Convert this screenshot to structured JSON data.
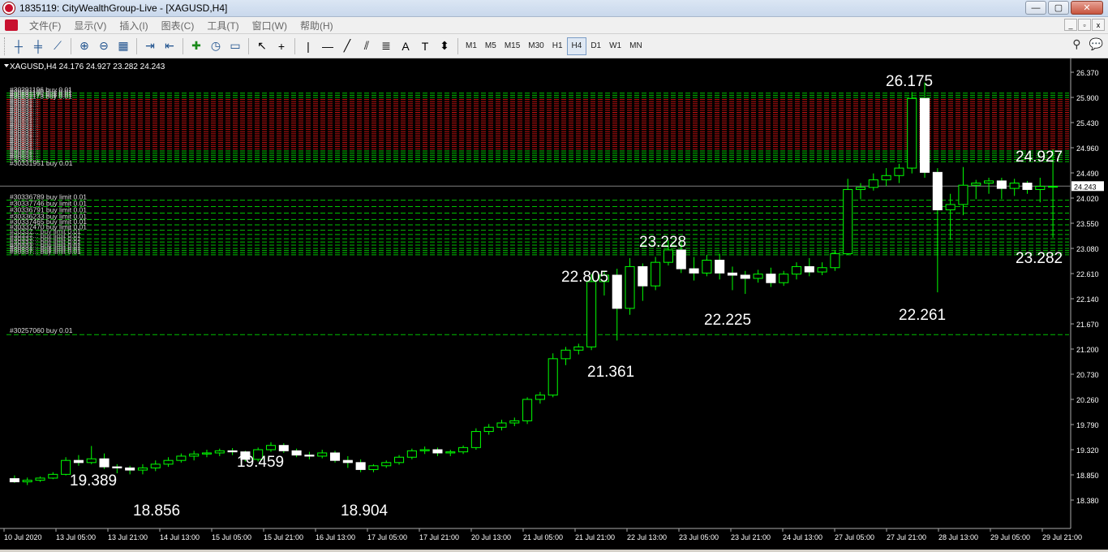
{
  "window": {
    "title": "1835119: CityWealthGroup-Live - [XAGUSD,H4]",
    "buttons": [
      "—",
      "▢",
      "✕"
    ]
  },
  "menu": {
    "items": [
      "文件(F)",
      "显示(V)",
      "插入(I)",
      "图表(C)",
      "工具(T)",
      "窗口(W)",
      "帮助(H)"
    ],
    "mdi_buttons": [
      "_",
      "▫",
      "x"
    ]
  },
  "toolbar": {
    "timeframes": [
      "M1",
      "M5",
      "M15",
      "M30",
      "H1",
      "H4",
      "D1",
      "W1",
      "MN"
    ],
    "active_timeframe": "H4"
  },
  "chart": {
    "header": "XAGUSD,H4  24.176 24.927 23.282 24.243",
    "current_price": "24.243",
    "colors": {
      "background": "#000000",
      "up_body": "#ffffff",
      "down_body": "#ffffff",
      "wick": "#00ff00",
      "grid": "#222222",
      "order_line": "#00c000",
      "stop_line": "#c00000",
      "price_line": "#808080"
    },
    "order_labels_top": [
      "#30291196 buy 0.01",
      "#30291180 buy 0.01",
      "#30291175 buy 0.01",
      "#30291173 buy 0.01"
    ],
    "order_labels_top_bottom": [
      "#30331951 buy 0.01"
    ],
    "limit_labels": [
      "#30336789 buy limit 0.01",
      "#30337746 buy limit 0.01",
      "#30336791 buy limit 0.01",
      "#30336233 buy limit 0.01",
      "#30337465 buy limit 0.01",
      "#30337470 buy limit 0.01"
    ],
    "single_order_label": "#30257060 buy 0.01",
    "annotations": [
      {
        "text": "26.175"
      },
      {
        "text": "24.927"
      },
      {
        "text": "23.228"
      },
      {
        "text": "22.805"
      },
      {
        "text": "22.225"
      },
      {
        "text": "22.261"
      },
      {
        "text": "23.282"
      },
      {
        "text": "21.361"
      },
      {
        "text": "19.459"
      },
      {
        "text": "19.389"
      },
      {
        "text": "18.856"
      },
      {
        "text": "18.904"
      }
    ]
  },
  "chart_data": {
    "type": "candlestick",
    "symbol": "XAGUSD",
    "timeframe": "H4",
    "y_ticks": [
      "26.370",
      "25.900",
      "25.430",
      "24.960",
      "24.490",
      "24.020",
      "23.550",
      "23.080",
      "22.610",
      "22.140",
      "21.670",
      "21.200",
      "20.730",
      "20.260",
      "19.790",
      "19.320",
      "18.850",
      "18.380"
    ],
    "ylim": [
      18.38,
      26.37
    ],
    "x_ticks": [
      "10 Jul 2020",
      "13 Jul 05:00",
      "13 Jul 21:00",
      "14 Jul 13:00",
      "15 Jul 05:00",
      "15 Jul 21:00",
      "16 Jul 13:00",
      "17 Jul 05:00",
      "17 Jul 21:00",
      "20 Jul 13:00",
      "21 Jul 05:00",
      "21 Jul 21:00",
      "22 Jul 13:00",
      "23 Jul 05:00",
      "23 Jul 21:00",
      "24 Jul 13:00",
      "27 Jul 05:00",
      "27 Jul 21:00",
      "28 Jul 13:00",
      "29 Jul 05:00",
      "29 Jul 21:00"
    ],
    "ohlc": [
      [
        18.78,
        18.84,
        18.7,
        18.72
      ],
      [
        18.72,
        18.8,
        18.66,
        18.75
      ],
      [
        18.75,
        18.82,
        18.72,
        18.79
      ],
      [
        18.79,
        18.9,
        18.77,
        18.86
      ],
      [
        18.86,
        19.18,
        18.84,
        19.12
      ],
      [
        19.12,
        19.22,
        19.02,
        19.08
      ],
      [
        19.08,
        19.39,
        19.05,
        19.15
      ],
      [
        19.15,
        19.25,
        18.96,
        19.0
      ],
      [
        19.0,
        19.05,
        18.88,
        18.98
      ],
      [
        18.98,
        19.02,
        18.86,
        18.94
      ],
      [
        18.94,
        19.05,
        18.86,
        18.98
      ],
      [
        18.98,
        19.12,
        18.92,
        19.05
      ],
      [
        19.05,
        19.18,
        19.0,
        19.12
      ],
      [
        19.12,
        19.25,
        19.08,
        19.2
      ],
      [
        19.2,
        19.3,
        19.12,
        19.24
      ],
      [
        19.24,
        19.32,
        19.18,
        19.26
      ],
      [
        19.26,
        19.34,
        19.2,
        19.3
      ],
      [
        19.3,
        19.35,
        19.22,
        19.28
      ],
      [
        19.28,
        19.3,
        19.1,
        19.14
      ],
      [
        19.14,
        19.36,
        19.1,
        19.32
      ],
      [
        19.32,
        19.46,
        19.28,
        19.4
      ],
      [
        19.4,
        19.44,
        19.26,
        19.3
      ],
      [
        19.3,
        19.34,
        19.18,
        19.22
      ],
      [
        19.22,
        19.28,
        19.14,
        19.2
      ],
      [
        19.2,
        19.32,
        19.16,
        19.26
      ],
      [
        19.26,
        19.3,
        19.08,
        19.12
      ],
      [
        19.12,
        19.2,
        18.98,
        19.08
      ],
      [
        19.08,
        19.14,
        18.9,
        18.95
      ],
      [
        18.95,
        19.05,
        18.9,
        19.02
      ],
      [
        19.02,
        19.12,
        18.98,
        19.08
      ],
      [
        19.08,
        19.22,
        19.04,
        19.18
      ],
      [
        19.18,
        19.34,
        19.14,
        19.3
      ],
      [
        19.3,
        19.38,
        19.24,
        19.32
      ],
      [
        19.32,
        19.36,
        19.2,
        19.26
      ],
      [
        19.26,
        19.32,
        19.2,
        19.28
      ],
      [
        19.28,
        19.4,
        19.24,
        19.36
      ],
      [
        19.36,
        19.72,
        19.32,
        19.66
      ],
      [
        19.66,
        19.8,
        19.6,
        19.74
      ],
      [
        19.74,
        19.88,
        19.68,
        19.82
      ],
      [
        19.82,
        19.92,
        19.76,
        19.86
      ],
      [
        19.86,
        20.3,
        19.8,
        20.26
      ],
      [
        20.26,
        20.4,
        20.18,
        20.34
      ],
      [
        20.34,
        21.12,
        20.3,
        21.02
      ],
      [
        21.02,
        21.24,
        20.9,
        21.18
      ],
      [
        21.18,
        21.3,
        21.1,
        21.24
      ],
      [
        21.24,
        22.6,
        21.18,
        22.46
      ],
      [
        22.46,
        22.66,
        22.2,
        22.58
      ],
      [
        22.58,
        22.7,
        21.36,
        21.96
      ],
      [
        21.96,
        22.9,
        21.84,
        22.74
      ],
      [
        22.74,
        22.8,
        22.1,
        22.38
      ],
      [
        22.38,
        22.92,
        22.3,
        22.82
      ],
      [
        22.82,
        23.23,
        22.76,
        23.05
      ],
      [
        23.05,
        23.18,
        22.62,
        22.7
      ],
      [
        22.7,
        22.92,
        22.48,
        22.62
      ],
      [
        22.62,
        22.96,
        22.56,
        22.86
      ],
      [
        22.86,
        22.98,
        22.5,
        22.62
      ],
      [
        22.62,
        22.74,
        22.3,
        22.58
      ],
      [
        22.58,
        22.66,
        22.23,
        22.52
      ],
      [
        22.52,
        22.68,
        22.44,
        22.6
      ],
      [
        22.6,
        22.72,
        22.36,
        22.44
      ],
      [
        22.44,
        22.66,
        22.38,
        22.6
      ],
      [
        22.6,
        22.82,
        22.5,
        22.74
      ],
      [
        22.74,
        22.9,
        22.56,
        22.64
      ],
      [
        22.64,
        22.82,
        22.58,
        22.72
      ],
      [
        22.72,
        23.04,
        22.66,
        22.98
      ],
      [
        22.98,
        24.38,
        22.96,
        24.18
      ],
      [
        24.18,
        24.3,
        24.0,
        24.22
      ],
      [
        24.22,
        24.48,
        24.16,
        24.36
      ],
      [
        24.36,
        24.58,
        24.24,
        24.44
      ],
      [
        24.44,
        24.66,
        24.3,
        24.58
      ],
      [
        24.58,
        26.0,
        24.48,
        25.88
      ],
      [
        25.88,
        26.18,
        24.4,
        24.5
      ],
      [
        24.5,
        24.58,
        22.26,
        23.8
      ],
      [
        23.8,
        24.1,
        23.24,
        23.9
      ],
      [
        23.9,
        24.6,
        23.7,
        24.26
      ],
      [
        24.26,
        24.36,
        24.0,
        24.3
      ],
      [
        24.3,
        24.4,
        24.1,
        24.34
      ],
      [
        24.34,
        24.4,
        24.0,
        24.2
      ],
      [
        24.2,
        24.38,
        24.06,
        24.3
      ],
      [
        24.3,
        24.34,
        24.1,
        24.18
      ],
      [
        24.18,
        24.4,
        23.94,
        24.24
      ],
      [
        24.24,
        24.93,
        23.28,
        24.24
      ]
    ],
    "orders_upper": [
      25.98,
      25.94,
      25.9,
      25.86,
      25.82,
      25.78,
      25.74,
      25.7,
      25.66,
      25.62,
      25.58,
      25.54,
      25.5,
      25.46,
      25.42,
      25.38,
      25.34,
      25.3,
      25.26,
      25.22,
      25.18,
      25.14,
      25.1,
      25.06,
      25.02,
      24.98,
      24.94,
      24.9,
      24.86,
      24.82,
      24.78,
      24.74,
      24.7
    ],
    "orders_lower": [
      23.98,
      23.86,
      23.74,
      23.62,
      23.52,
      23.42,
      23.34,
      23.26,
      23.2,
      23.14,
      23.08,
      23.04,
      23.0,
      22.96
    ],
    "order_single": 21.47,
    "price_line": 24.243
  }
}
